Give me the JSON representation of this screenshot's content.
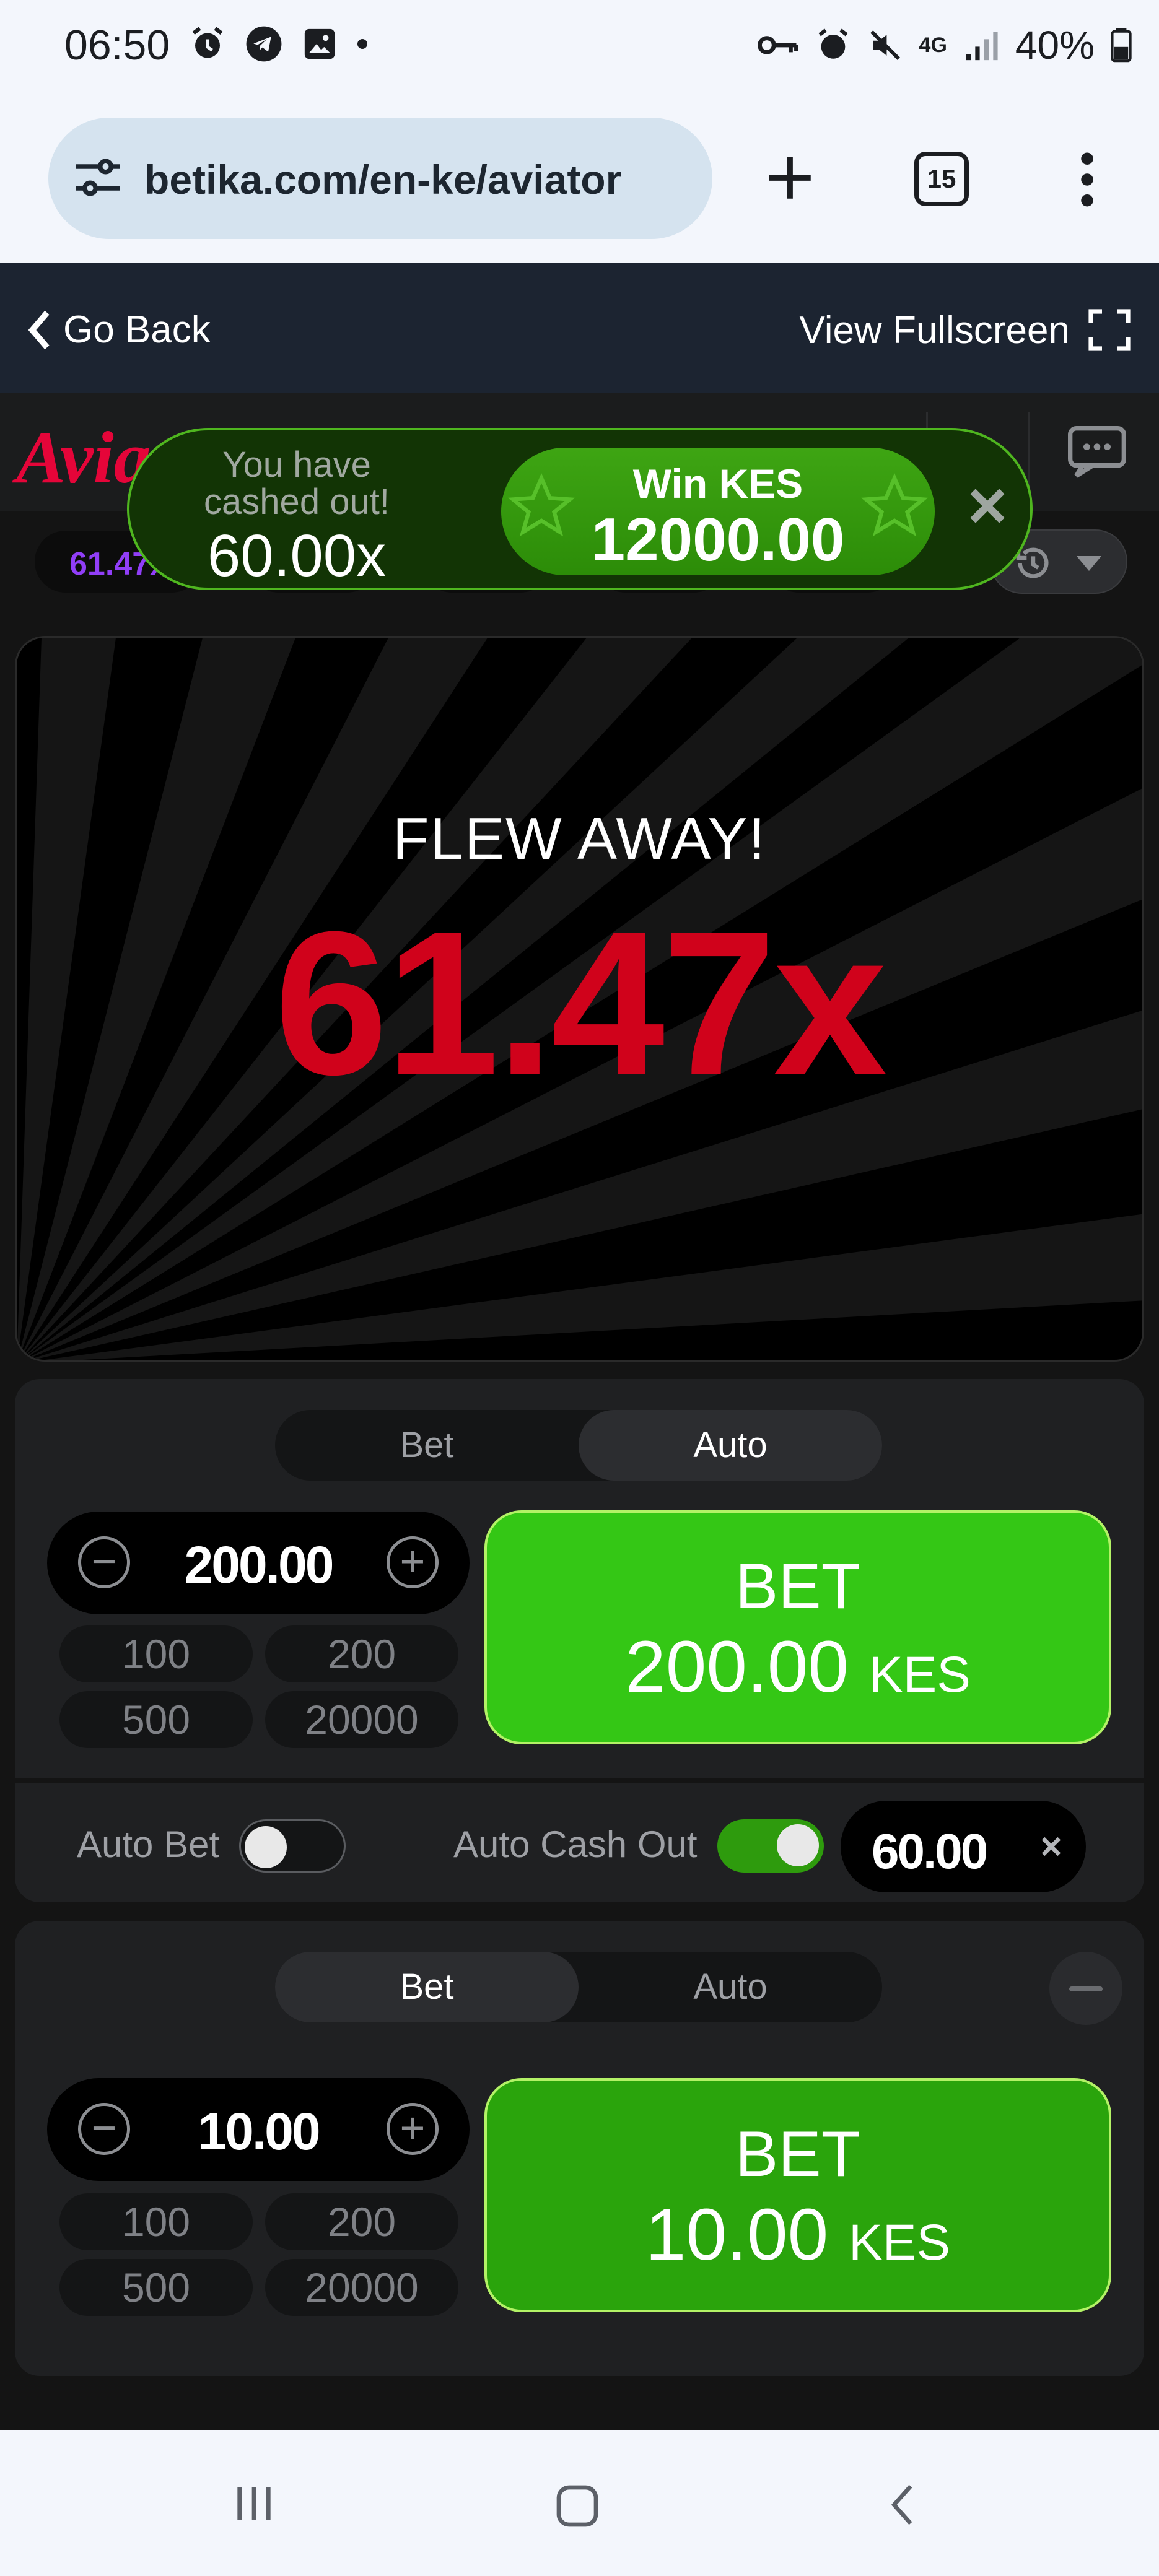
{
  "status_bar": {
    "time": "06:50",
    "battery": "40%",
    "network": "4G"
  },
  "browser": {
    "url": "betika.com/en-ke/aviator",
    "tab_count": "15"
  },
  "top_bar": {
    "back_label": "Go Back",
    "fullscreen_label": "View Fullscreen"
  },
  "game": {
    "logo": "Aviator",
    "history_first": "61.47x",
    "toast": {
      "line1": "You have cashed out!",
      "multiplier": "60.00x",
      "win_label": "Win KES",
      "win_amount": "12000.00"
    },
    "flew_away": "FLEW AWAY!",
    "multiplier": "61.47x"
  },
  "panel1": {
    "tabs": [
      "Bet",
      "Auto"
    ],
    "active_tab": "Auto",
    "amount": "200.00",
    "quick": [
      "100",
      "200",
      "500",
      "20000"
    ],
    "bet_label": "BET",
    "bet_amount": "200.00",
    "currency": "KES",
    "auto_bet_label": "Auto Bet",
    "auto_bet_on": false,
    "auto_cashout_label": "Auto Cash Out",
    "auto_cashout_on": true,
    "auto_cashout_value": "60.00"
  },
  "panel2": {
    "tabs": [
      "Bet",
      "Auto"
    ],
    "active_tab": "Bet",
    "amount": "10.00",
    "quick": [
      "100",
      "200",
      "500",
      "20000"
    ],
    "bet_label": "BET",
    "bet_amount": "10.00",
    "currency": "KES"
  },
  "colors": {
    "accent_red": "#d0021b",
    "bet_green": "#34c715",
    "toast_green": "#123405",
    "purple": "#913ef8"
  }
}
